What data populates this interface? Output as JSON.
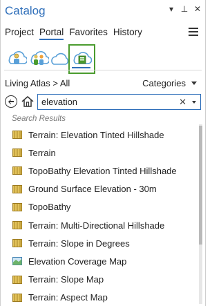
{
  "window": {
    "title": "Catalog"
  },
  "title_controls": {
    "dropdown": "▾",
    "pin": "⊥",
    "close": "✕"
  },
  "tabs": [
    {
      "label": "Project",
      "active": false
    },
    {
      "label": "Portal",
      "active": true
    },
    {
      "label": "Favorites",
      "active": false
    },
    {
      "label": "History",
      "active": false
    }
  ],
  "portal_views": [
    {
      "icon": "my-content-icon",
      "selected": false
    },
    {
      "icon": "groups-icon",
      "selected": false
    },
    {
      "icon": "all-portal-icon",
      "selected": false
    },
    {
      "icon": "living-atlas-icon",
      "selected": true
    }
  ],
  "breadcrumb": "Living Atlas > All",
  "categories_label": "Categories",
  "search": {
    "value": "elevation"
  },
  "results_label": "Search Results",
  "results": [
    {
      "title": "Terrain: Elevation Tinted Hillshade",
      "icon": "image-service-icon"
    },
    {
      "title": "Terrain",
      "icon": "image-service-icon"
    },
    {
      "title": "TopoBathy Elevation Tinted Hillshade",
      "icon": "image-service-icon"
    },
    {
      "title": "Ground Surface Elevation - 30m",
      "icon": "image-service-icon"
    },
    {
      "title": "TopoBathy",
      "icon": "image-service-icon"
    },
    {
      "title": "Terrain: Multi-Directional Hillshade",
      "icon": "image-service-icon"
    },
    {
      "title": "Terrain: Slope in Degrees",
      "icon": "image-service-icon"
    },
    {
      "title": "Elevation Coverage Map",
      "icon": "map-icon"
    },
    {
      "title": "Terrain: Slope Map",
      "icon": "image-service-icon"
    },
    {
      "title": "Terrain: Aspect Map",
      "icon": "image-service-icon"
    }
  ],
  "colors": {
    "accent": "#2f6fba",
    "selected_border": "#4a9b2e",
    "icon_yellow": "#e2c25a",
    "icon_blue": "#5aa0d8"
  }
}
